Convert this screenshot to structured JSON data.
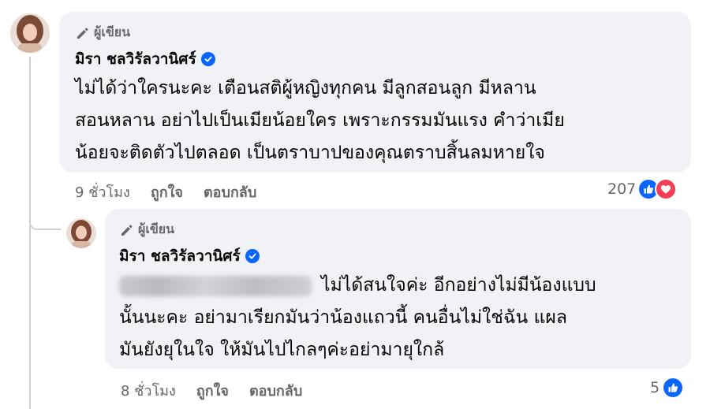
{
  "comments": [
    {
      "author_badge": "ผู้เขียน",
      "author_name": "มิรา ชลวิรัลวานิศร์",
      "text_lines": [
        "ไม่ได้ว่าใครนะคะ เตือนสติผู้หญิงทุกคน มีลูกสอนลูก มีหลาน",
        "สอนหลาน อย่าไปเป็นเมียน้อยใคร เพราะกรรมมันแรง คำว่าเมีย",
        "น้อยจะติดตัวไปตลอด เป็นตราบาปของคุณตราบสิ้นลมหายใจ"
      ],
      "time": "9 ชั่วโมง",
      "like_label": "ถูกใจ",
      "reply_label": "ตอบกลับ",
      "reaction_count": "207",
      "reaction_icons": [
        "like-icon",
        "love-icon"
      ]
    },
    {
      "author_badge": "ผู้เขียน",
      "author_name": "มิรา ชลวิรัลวานิศร์",
      "text_lines": [
        "ไม่ได้สนใจค่ะ อีกอย่างไม่มีน้องแบบ",
        "นั้นนะคะ อย่ามาเรียกมันว่าน้องแถวนี้ คนอื่นไม่ใช่ฉัน แผล",
        "มันยังยุในใจ ให้มันไปไกลๆค่ะอย่ามายุใกล้"
      ],
      "time": "8 ชั่วโมง",
      "like_label": "ถูกใจ",
      "reply_label": "ตอบกลับ",
      "reaction_count": "5",
      "reaction_icons": [
        "like-icon"
      ]
    }
  ],
  "colors": {
    "bubble": "#f0f2f5",
    "meta_text": "#65676b",
    "verified_blue": "#0866ff",
    "love_red": "#f33e58"
  }
}
